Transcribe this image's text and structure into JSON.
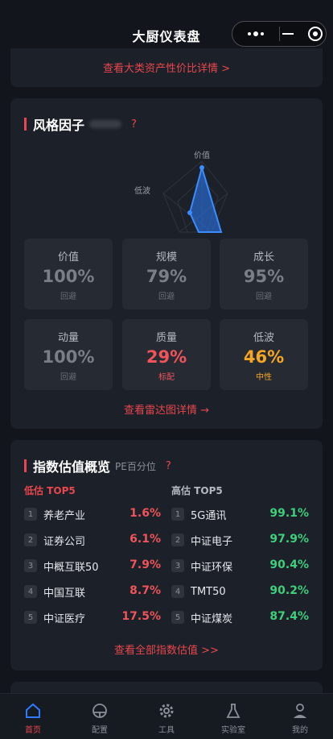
{
  "app": {
    "title": "大厨仪表盘"
  },
  "asset_card": {
    "link": "查看大类资产性价比详情 >"
  },
  "style_factor": {
    "title": "风格因子",
    "help": "?",
    "radar_labels": {
      "top": "价值",
      "left": "低波"
    },
    "tiles": [
      {
        "name": "价值",
        "value": "100%",
        "status": "回避",
        "tone": "grey"
      },
      {
        "name": "规模",
        "value": "79%",
        "status": "回避",
        "tone": "grey"
      },
      {
        "name": "成长",
        "value": "95%",
        "status": "回避",
        "tone": "grey"
      },
      {
        "name": "动量",
        "value": "100%",
        "status": "回避",
        "tone": "grey"
      },
      {
        "name": "质量",
        "value": "29%",
        "status": "标配",
        "tone": "red"
      },
      {
        "name": "低波",
        "value": "46%",
        "status": "中性",
        "tone": "orange"
      }
    ],
    "link": "查看雷达图详情 →"
  },
  "index_valuation": {
    "title": "指数估值概览",
    "subtitle": "PE百分位",
    "help": "?",
    "low_title": "低估 TOP5",
    "high_title": "高估 TOP5",
    "low": [
      {
        "rank": "1",
        "name": "养老产业",
        "value": "1.6%"
      },
      {
        "rank": "2",
        "name": "证券公司",
        "value": "6.1%"
      },
      {
        "rank": "3",
        "name": "中概互联50",
        "value": "7.9%"
      },
      {
        "rank": "4",
        "name": "中国互联",
        "value": "8.7%"
      },
      {
        "rank": "5",
        "name": "中证医疗",
        "value": "17.5%"
      }
    ],
    "high": [
      {
        "rank": "1",
        "name": "5G通讯",
        "value": "99.1%"
      },
      {
        "rank": "2",
        "name": "中证电子",
        "value": "97.9%"
      },
      {
        "rank": "3",
        "name": "中证环保",
        "value": "90.4%"
      },
      {
        "rank": "4",
        "name": "TMT50",
        "value": "90.2%"
      },
      {
        "rank": "5",
        "name": "中证煤炭",
        "value": "87.4%"
      }
    ],
    "link": "查看全部指数估值 >>"
  },
  "tabbar": {
    "items": [
      {
        "label": "首页",
        "icon": "home-icon",
        "active": true
      },
      {
        "label": "配置",
        "icon": "steering-icon",
        "active": false
      },
      {
        "label": "工具",
        "icon": "gear-icon",
        "active": false
      },
      {
        "label": "实验室",
        "icon": "flask-icon",
        "active": false
      },
      {
        "label": "我的",
        "icon": "user-icon",
        "active": false
      }
    ]
  },
  "colors": {
    "accent": "#e8474d",
    "green": "#3ecf7a",
    "orange": "#f5a623",
    "bg": "#12151b",
    "card": "#1c2028"
  }
}
